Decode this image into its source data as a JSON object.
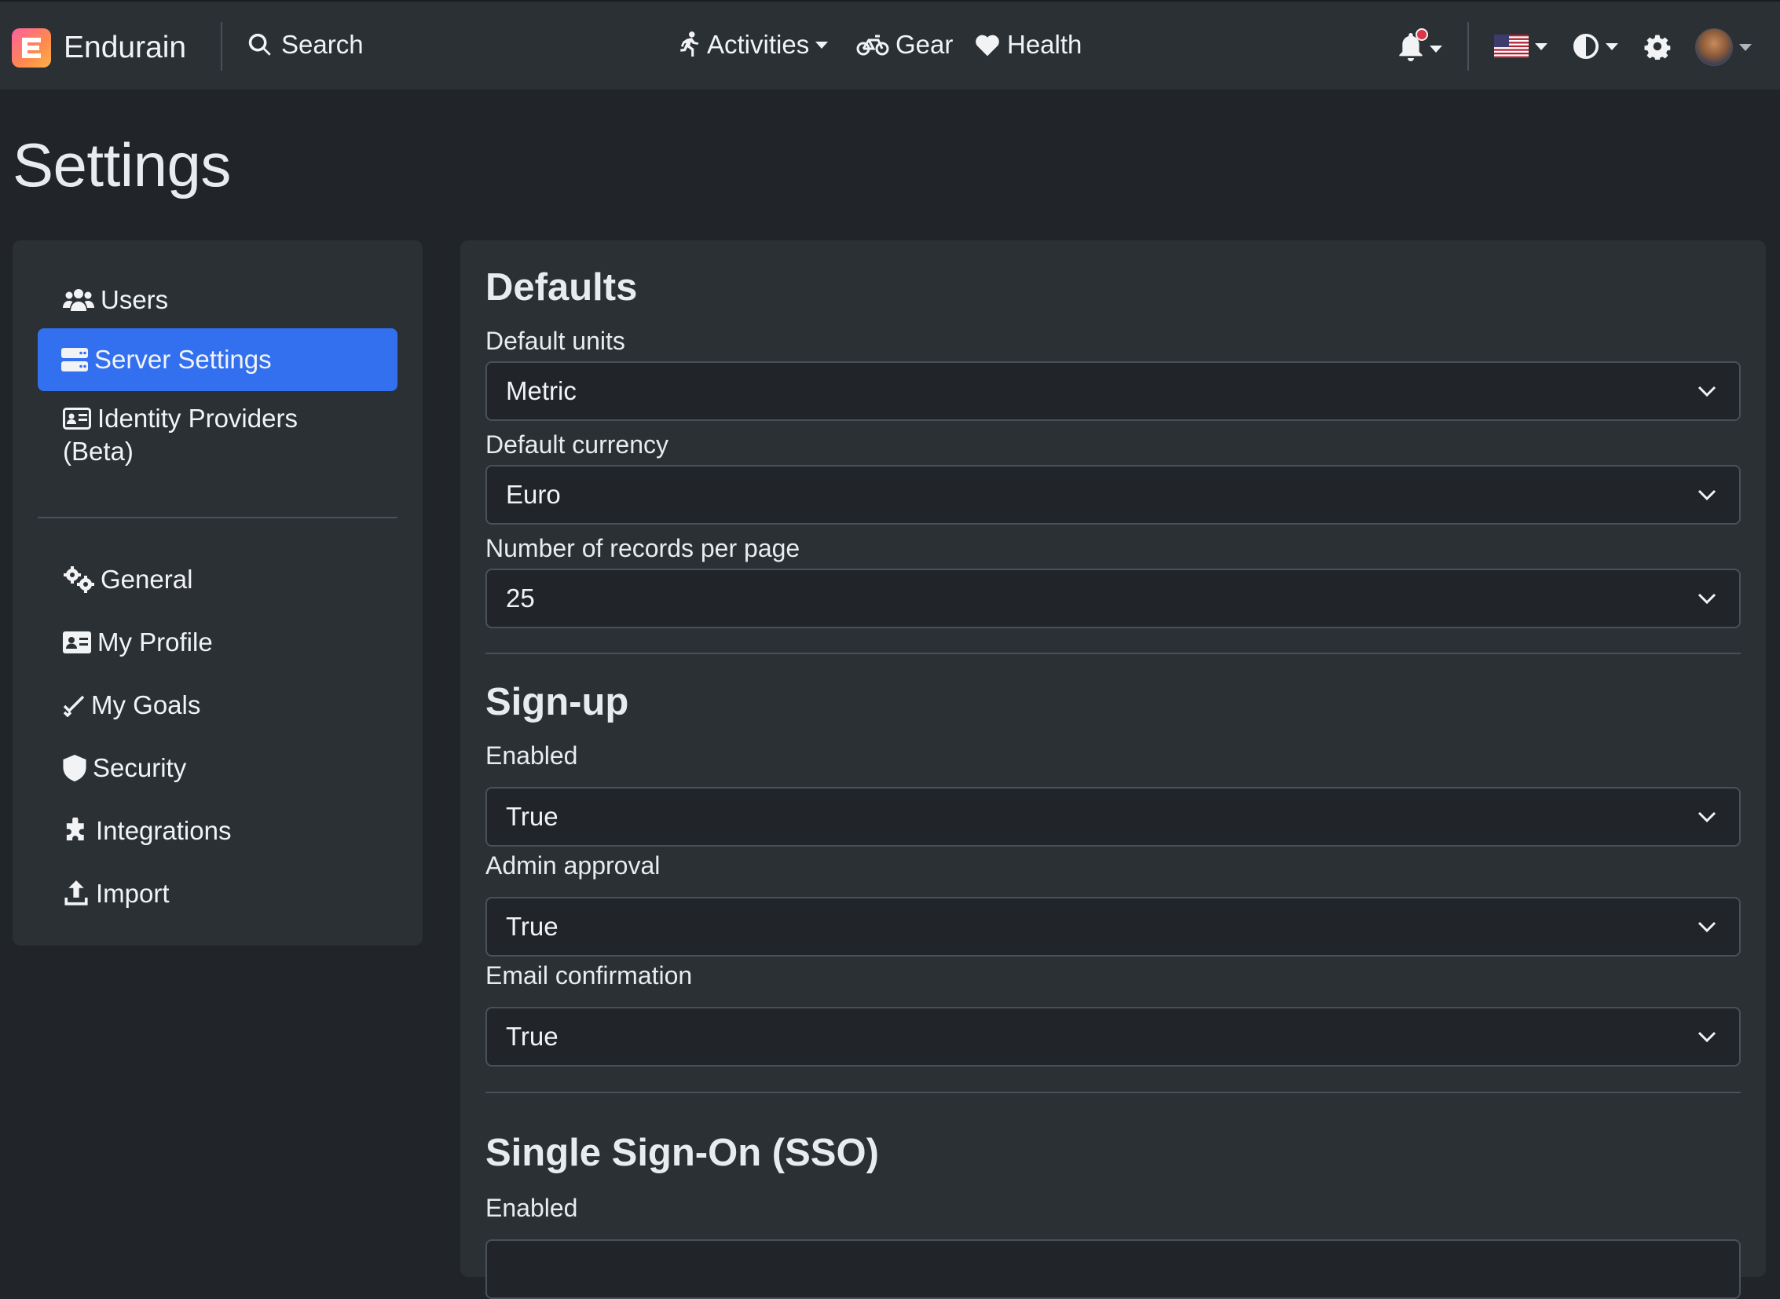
{
  "navbar": {
    "brand": "Endurain",
    "search_label": "Search",
    "activities_label": "Activities",
    "gear_label": "Gear",
    "health_label": "Health"
  },
  "page": {
    "title": "Settings"
  },
  "sidebar": {
    "items": [
      {
        "label": "Users"
      },
      {
        "label": "Server Settings",
        "active": true
      },
      {
        "label": "Identity Providers",
        "label2": "(Beta)"
      },
      {
        "label": "General"
      },
      {
        "label": "My Profile"
      },
      {
        "label": "My Goals"
      },
      {
        "label": "Security"
      },
      {
        "label": "Integrations"
      },
      {
        "label": "Import"
      }
    ]
  },
  "defaults": {
    "title": "Defaults",
    "units_label": "Default units",
    "units_value": "Metric",
    "currency_label": "Default currency",
    "currency_value": "Euro",
    "records_label": "Number of records per page",
    "records_value": "25"
  },
  "signup": {
    "title": "Sign-up",
    "enabled_label": "Enabled",
    "enabled_value": "True",
    "admin_label": "Admin approval",
    "admin_value": "True",
    "email_label": "Email confirmation",
    "email_value": "True"
  },
  "sso": {
    "title": "Single Sign-On (SSO)",
    "enabled_label": "Enabled"
  },
  "colors": {
    "background": "#212529",
    "card": "#2b3035",
    "accent": "#3370f0",
    "notification_dot": "#dc3545"
  }
}
